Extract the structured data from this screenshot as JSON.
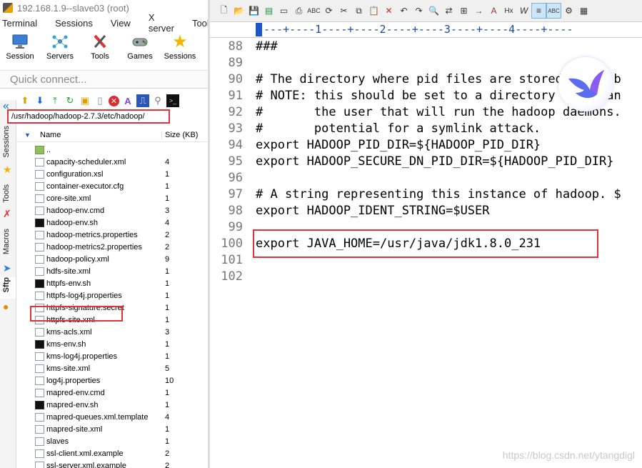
{
  "moba": {
    "title": "192.168.1.9--slave03 (root)",
    "menu": [
      "Terminal",
      "Sessions",
      "View",
      "X server",
      "Tools"
    ],
    "toolbar": [
      {
        "label": "Session",
        "icon": "session-icon"
      },
      {
        "label": "Servers",
        "icon": "servers-icon"
      },
      {
        "label": "Tools",
        "icon": "tools-icon"
      },
      {
        "label": "Games",
        "icon": "games-icon"
      },
      {
        "label": "Sessions",
        "icon": "star-icon"
      }
    ],
    "quick_connect": "Quick connect...",
    "side_tabs": [
      "Sessions",
      "Tools",
      "Macros",
      "Sftp"
    ],
    "sftp": {
      "path": "/usr/hadoop/hadoop-2.7.3/etc/hadoop/",
      "col_name": "Name",
      "col_size": "Size (KB)",
      "files": [
        {
          "name": "..",
          "size": "",
          "kind": "folder"
        },
        {
          "name": "capacity-scheduler.xml",
          "size": "4",
          "kind": "file"
        },
        {
          "name": "configuration.xsl",
          "size": "1",
          "kind": "file"
        },
        {
          "name": "container-executor.cfg",
          "size": "1",
          "kind": "file"
        },
        {
          "name": "core-site.xml",
          "size": "1",
          "kind": "file"
        },
        {
          "name": "hadoop-env.cmd",
          "size": "3",
          "kind": "file"
        },
        {
          "name": "hadoop-env.sh",
          "size": "4",
          "kind": "sh"
        },
        {
          "name": "hadoop-metrics.properties",
          "size": "2",
          "kind": "file"
        },
        {
          "name": "hadoop-metrics2.properties",
          "size": "2",
          "kind": "file"
        },
        {
          "name": "hadoop-policy.xml",
          "size": "9",
          "kind": "file"
        },
        {
          "name": "hdfs-site.xml",
          "size": "1",
          "kind": "file"
        },
        {
          "name": "httpfs-env.sh",
          "size": "1",
          "kind": "sh"
        },
        {
          "name": "httpfs-log4j.properties",
          "size": "1",
          "kind": "file"
        },
        {
          "name": "httpfs-signature.secret",
          "size": "1",
          "kind": "file"
        },
        {
          "name": "httpfs-site.xml",
          "size": "1",
          "kind": "file"
        },
        {
          "name": "kms-acls.xml",
          "size": "3",
          "kind": "file"
        },
        {
          "name": "kms-env.sh",
          "size": "1",
          "kind": "sh"
        },
        {
          "name": "kms-log4j.properties",
          "size": "1",
          "kind": "file"
        },
        {
          "name": "kms-site.xml",
          "size": "5",
          "kind": "file"
        },
        {
          "name": "log4j.properties",
          "size": "10",
          "kind": "file"
        },
        {
          "name": "mapred-env.cmd",
          "size": "1",
          "kind": "file"
        },
        {
          "name": "mapred-env.sh",
          "size": "1",
          "kind": "sh"
        },
        {
          "name": "mapred-queues.xml.template",
          "size": "4",
          "kind": "file"
        },
        {
          "name": "mapred-site.xml",
          "size": "1",
          "kind": "file"
        },
        {
          "name": "slaves",
          "size": "1",
          "kind": "file"
        },
        {
          "name": "ssl-client.xml.example",
          "size": "2",
          "kind": "file"
        },
        {
          "name": "ssl-server.xml.example",
          "size": "2",
          "kind": "file"
        }
      ]
    }
  },
  "editor": {
    "ruler": "---+----1----+----2----+----3----+----4----+----",
    "lines": [
      {
        "num": "88",
        "text": "###"
      },
      {
        "num": "89",
        "text": ""
      },
      {
        "num": "90",
        "text": "# The directory where pid files are stored. /tmp b"
      },
      {
        "num": "91",
        "text": "# NOTE: this should be set to a directory that can"
      },
      {
        "num": "92",
        "text": "#       the user that will run the hadoop daemons."
      },
      {
        "num": "93",
        "text": "#       potential for a symlink attack."
      },
      {
        "num": "94",
        "text": "export HADOOP_PID_DIR=${HADOOP_PID_DIR}"
      },
      {
        "num": "95",
        "text": "export HADOOP_SECURE_DN_PID_DIR=${HADOOP_PID_DIR}"
      },
      {
        "num": "96",
        "text": ""
      },
      {
        "num": "97",
        "text": "# A string representing this instance of hadoop. $"
      },
      {
        "num": "98",
        "text": "export HADOOP_IDENT_STRING=$USER"
      },
      {
        "num": "99",
        "text": ""
      },
      {
        "num": "100",
        "text": "export JAVA_HOME=/usr/java/jdk1.8.0_231"
      },
      {
        "num": "101",
        "text": ""
      },
      {
        "num": "102",
        "text": ""
      }
    ]
  },
  "watermark": "https://blog.csdn.net/ytangdigl",
  "colors": {
    "highlight": "#e2333a",
    "ruler_text": "#1a4aa8",
    "line_number": "#777777"
  }
}
